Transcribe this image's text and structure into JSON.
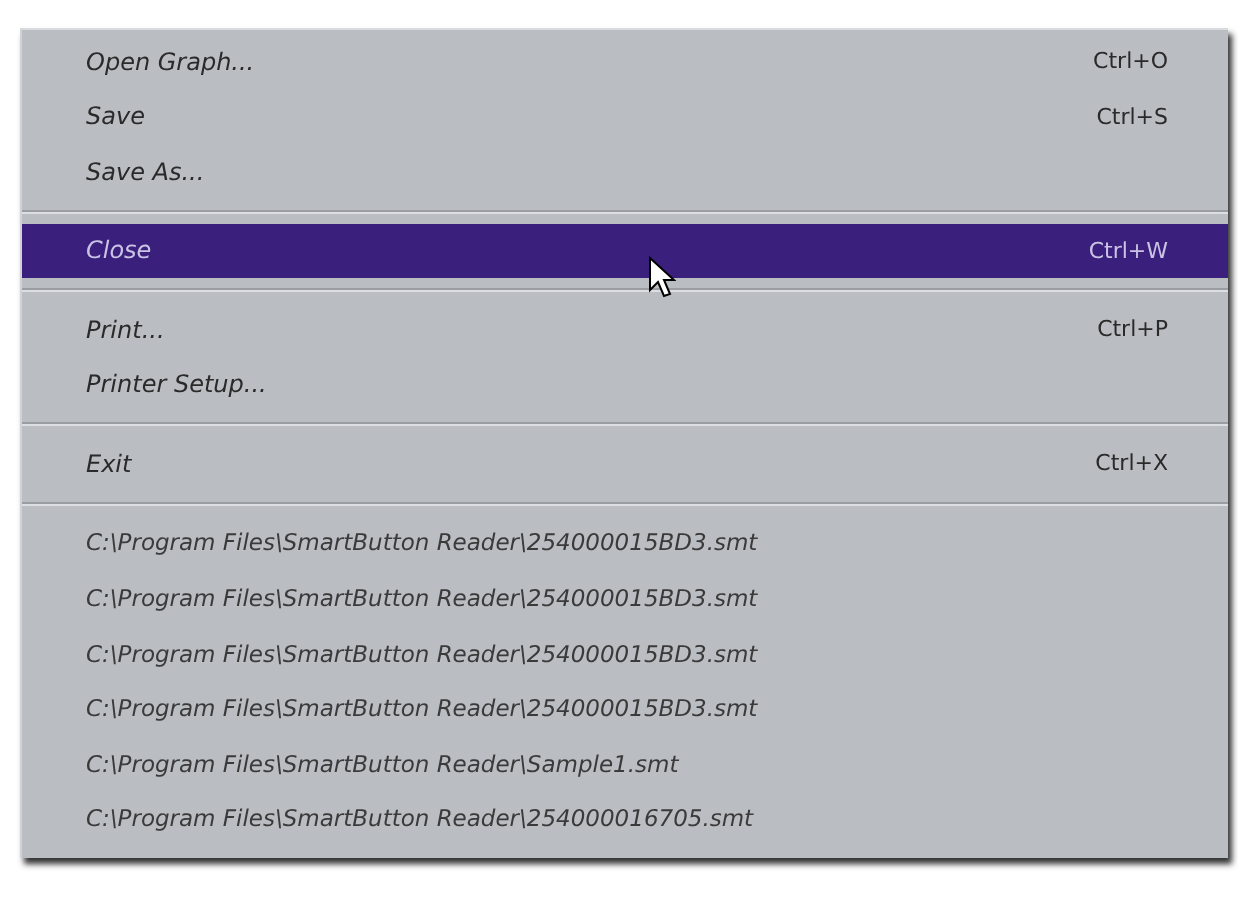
{
  "menu": {
    "groups": [
      {
        "items": [
          {
            "kind": "command",
            "label": "Open Graph...",
            "shortcut": "Ctrl+O",
            "selected": false
          },
          {
            "kind": "command",
            "label": "Save",
            "shortcut": "Ctrl+S",
            "selected": false
          },
          {
            "kind": "command",
            "label": "Save As...",
            "selected": false
          }
        ]
      },
      {
        "items": [
          {
            "kind": "command",
            "label": "Close",
            "shortcut": "Ctrl+W",
            "selected": true
          }
        ]
      },
      {
        "items": [
          {
            "kind": "command",
            "label": "Print...",
            "shortcut": "Ctrl+P",
            "selected": false
          },
          {
            "kind": "command",
            "label": "Printer Setup...",
            "selected": false
          }
        ]
      },
      {
        "items": [
          {
            "kind": "command",
            "label": "Exit",
            "shortcut": "Ctrl+X",
            "selected": false
          }
        ]
      },
      {
        "items": [
          {
            "kind": "recent",
            "label": "C:\\Program Files\\SmartButton Reader\\254000015BD3.smt",
            "selected": false
          },
          {
            "kind": "recent",
            "label": "C:\\Program Files\\SmartButton Reader\\254000015BD3.smt",
            "selected": false
          },
          {
            "kind": "recent",
            "label": "C:\\Program Files\\SmartButton Reader\\254000015BD3.smt",
            "selected": false
          },
          {
            "kind": "recent",
            "label": "C:\\Program Files\\SmartButton Reader\\254000015BD3.smt",
            "selected": false
          },
          {
            "kind": "recent",
            "label": "C:\\Program Files\\SmartButton Reader\\Sample1.smt",
            "selected": false
          },
          {
            "kind": "recent",
            "label": "C:\\Program Files\\SmartButton Reader\\254000016705.smt",
            "selected": false
          }
        ]
      }
    ]
  }
}
